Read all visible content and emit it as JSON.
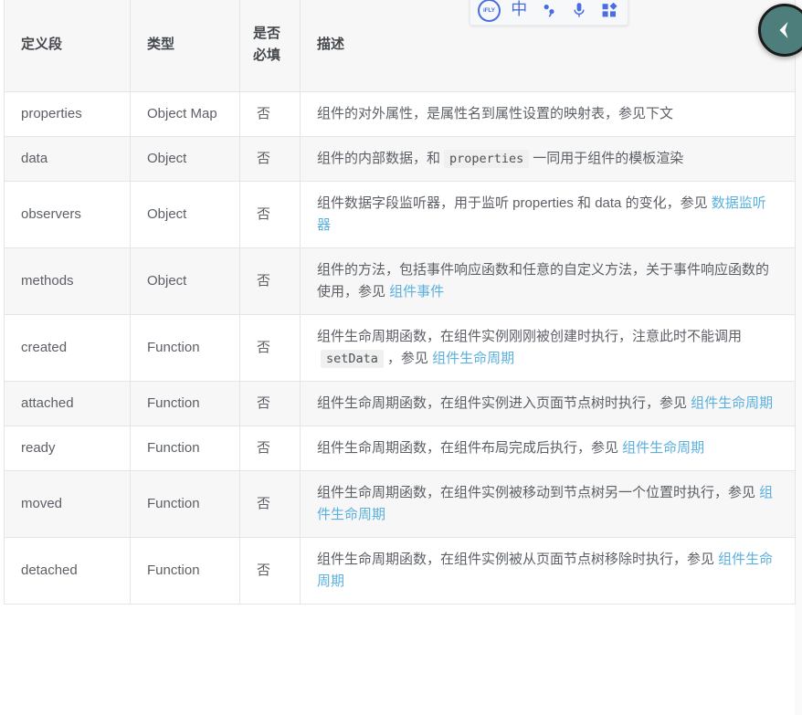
{
  "page": {
    "background_color": "#ffffff",
    "text_color": "#5c6066",
    "link_color": "#5bb0dd",
    "header_bg": "#f7f7f7",
    "row_alt_bg": "#f7f7f7",
    "border_color": "#e3e6e8"
  },
  "table": {
    "headers": {
      "field": "定义段",
      "type": "类型",
      "required": "是否必填",
      "description": "描述"
    },
    "rows": [
      {
        "field": "properties",
        "type": "Object Map",
        "required": "否",
        "description_parts": [
          {
            "kind": "text",
            "text": "组件的对外属性，是属性名到属性设置的映射表，参见下文"
          }
        ]
      },
      {
        "field": "data",
        "type": "Object",
        "required": "否",
        "description_parts": [
          {
            "kind": "text",
            "text": "组件的内部数据，和"
          },
          {
            "kind": "code",
            "text": "properties"
          },
          {
            "kind": "text",
            "text": "一同用于组件的模板渲染"
          }
        ]
      },
      {
        "field": "observers",
        "type": "Object",
        "required": "否",
        "description_parts": [
          {
            "kind": "text",
            "text": "组件数据字段监听器，用于监听 properties 和 data 的变化，参见 "
          },
          {
            "kind": "link",
            "text": "数据监听器"
          }
        ]
      },
      {
        "field": "methods",
        "type": "Object",
        "required": "否",
        "description_parts": [
          {
            "kind": "text",
            "text": "组件的方法，包括事件响应函数和任意的自定义方法，关于事件响应函数的使用，参见 "
          },
          {
            "kind": "link",
            "text": "组件事件"
          }
        ]
      },
      {
        "field": "created",
        "type": "Function",
        "required": "否",
        "description_parts": [
          {
            "kind": "text",
            "text": "组件生命周期函数，在组件实例刚刚被创建时执行，注意此时不能调用"
          },
          {
            "kind": "code",
            "text": "setData"
          },
          {
            "kind": "text",
            "text": "，参见 "
          },
          {
            "kind": "link",
            "text": "组件生命周期"
          }
        ]
      },
      {
        "field": "attached",
        "type": "Function",
        "required": "否",
        "description_parts": [
          {
            "kind": "text",
            "text": "组件生命周期函数，在组件实例进入页面节点树时执行，参见 "
          },
          {
            "kind": "link",
            "text": "组件生命周期"
          }
        ]
      },
      {
        "field": "ready",
        "type": "Function",
        "required": "否",
        "description_parts": [
          {
            "kind": "text",
            "text": "组件生命周期函数，在组件布局完成后执行，参见 "
          },
          {
            "kind": "link",
            "text": "组件生命周期"
          }
        ]
      },
      {
        "field": "moved",
        "type": "Function",
        "required": "否",
        "description_parts": [
          {
            "kind": "text",
            "text": "组件生命周期函数，在组件实例被移动到节点树另一个位置时执行，参见 "
          },
          {
            "kind": "link",
            "text": "组件生命周期"
          }
        ]
      },
      {
        "field": "detached",
        "type": "Function",
        "required": "否",
        "description_parts": [
          {
            "kind": "text",
            "text": "组件生命周期函数，在组件实例被从页面节点树移除时执行，参见 "
          },
          {
            "kind": "link",
            "text": "组件生命周期"
          }
        ]
      }
    ]
  },
  "ime_toolbar": {
    "accent_color": "#4a6ee0",
    "background_color": "#f7f8fa",
    "items": [
      {
        "icon": "ifly-logo-icon",
        "label": "iFLY"
      },
      {
        "icon": "chinese-mode-icon",
        "label": "中"
      },
      {
        "icon": "punctuation-icon",
        "label": ""
      },
      {
        "icon": "microphone-icon",
        "label": ""
      },
      {
        "icon": "apps-grid-icon",
        "label": ""
      }
    ]
  },
  "float_button": {
    "icon": "chevron-left-icon",
    "background_color": "#4e7e7b",
    "border_color": "#1b1b1b"
  }
}
